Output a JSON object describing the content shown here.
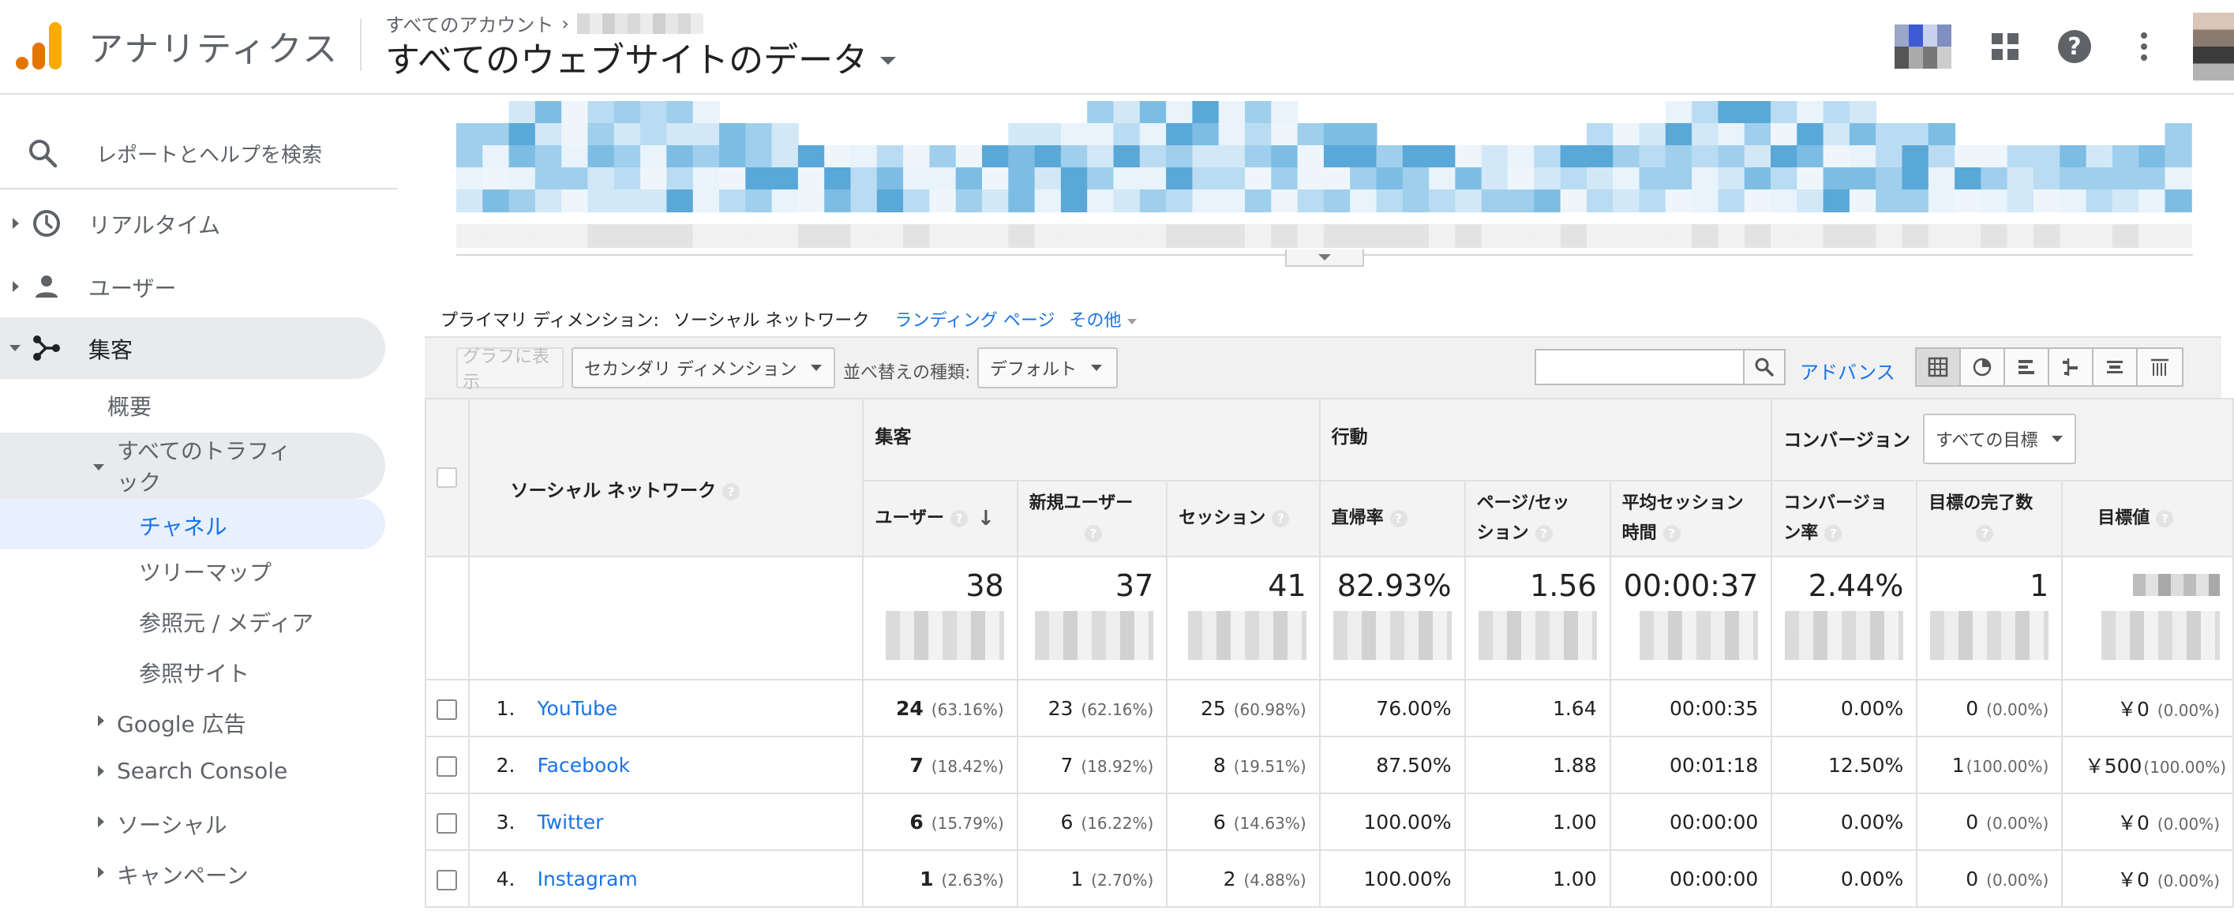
{
  "header": {
    "app_title": "アナリティクス",
    "breadcrumb": "すべてのアカウント",
    "property_title": "すべてのウェブサイトのデータ"
  },
  "sidebar": {
    "search_label": "レポートとヘルプを検索",
    "items": [
      {
        "label": "リアルタイム",
        "icon": "clock-icon"
      },
      {
        "label": "ユーザー",
        "icon": "person-icon"
      },
      {
        "label": "集客",
        "icon": "acquisition-icon"
      }
    ],
    "acquisition_children": {
      "overview": "概要",
      "all_traffic": "すべてのトラフィック",
      "all_traffic_line1": "すべてのトラフィ",
      "all_traffic_line2": "ック",
      "traffic_children": [
        "チャネル",
        "ツリーマップ",
        "参照元 / メディア",
        "参照サイト"
      ],
      "others": [
        "Google 広告",
        "Search Console",
        "ソーシャル",
        "キャンペーン"
      ]
    }
  },
  "report": {
    "primary_dimension_label": "プライマリ ディメンション:",
    "primary_dimension_current": "ソーシャル ネットワーク",
    "primary_dimension_links": [
      "ランディング ページ",
      "その他"
    ],
    "toolbar": {
      "plot_rows": "グラフに表示",
      "secondary_dimension": "セカンダリ ディメンション",
      "sort_type_label": "並べ替えの種類:",
      "sort_type_value": "デフォルト",
      "advanced": "アドバンス"
    },
    "table": {
      "dimension_header": "ソーシャル ネットワーク",
      "groups": {
        "acquisition": "集客",
        "behavior": "行動",
        "conversions": "コンバージョン",
        "goal_select": "すべての目標"
      },
      "columns": {
        "users": "ユーザー",
        "new_users": "新規ユーザー",
        "sessions": "セッション",
        "bounce_rate": "直帰率",
        "pages_per_session_1": "ページ/セッ",
        "pages_per_session_2": "ション",
        "avg_session_1": "平均セッション",
        "avg_session_2": "時間",
        "conv_rate_1": "コンバージョ",
        "conv_rate_2": "ン率",
        "goal_completions": "目標の完了数",
        "goal_value": "目標値"
      },
      "totals": {
        "users": "38",
        "new_users": "37",
        "sessions": "41",
        "bounce_rate": "82.93%",
        "pages_per_session": "1.56",
        "avg_session": "00:00:37",
        "conv_rate": "2.44%",
        "goal_completions": "1"
      },
      "rows": [
        {
          "idx": "1.",
          "name": "YouTube",
          "users": "24",
          "users_pct": "(63.16%)",
          "new_users": "23",
          "new_users_pct": "(62.16%)",
          "sessions": "25",
          "sessions_pct": "(60.98%)",
          "bounce_rate": "76.00%",
          "pps": "1.64",
          "avg": "00:00:35",
          "conv": "0.00%",
          "goals": "0",
          "goals_pct": "(0.00%)",
          "value": "￥0",
          "value_pct": "(0.00%)"
        },
        {
          "idx": "2.",
          "name": "Facebook",
          "users": "7",
          "users_pct": "(18.42%)",
          "new_users": "7",
          "new_users_pct": "(18.92%)",
          "sessions": "8",
          "sessions_pct": "(19.51%)",
          "bounce_rate": "87.50%",
          "pps": "1.88",
          "avg": "00:01:18",
          "conv": "12.50%",
          "goals": "1",
          "goals_pct": "(100.00%)",
          "value": "￥500",
          "value_pct": "(100.00%)"
        },
        {
          "idx": "3.",
          "name": "Twitter",
          "users": "6",
          "users_pct": "(15.79%)",
          "new_users": "6",
          "new_users_pct": "(16.22%)",
          "sessions": "6",
          "sessions_pct": "(14.63%)",
          "bounce_rate": "100.00%",
          "pps": "1.00",
          "avg": "00:00:00",
          "conv": "0.00%",
          "goals": "0",
          "goals_pct": "(0.00%)",
          "value": "￥0",
          "value_pct": "(0.00%)"
        },
        {
          "idx": "4.",
          "name": "Instagram",
          "users": "1",
          "users_pct": "(2.63%)",
          "new_users": "1",
          "new_users_pct": "(2.70%)",
          "sessions": "2",
          "sessions_pct": "(4.88%)",
          "bounce_rate": "100.00%",
          "pps": "1.00",
          "avg": "00:00:00",
          "conv": "0.00%",
          "goals": "0",
          "goals_pct": "(0.00%)",
          "value": "￥0",
          "value_pct": "(0.00%)"
        }
      ]
    }
  },
  "colors": {
    "accent": "#1a73e8",
    "logo_orange": "#f9ab00",
    "logo_dark_orange": "#e37400",
    "sidebar_active": "#e8f0fe"
  }
}
